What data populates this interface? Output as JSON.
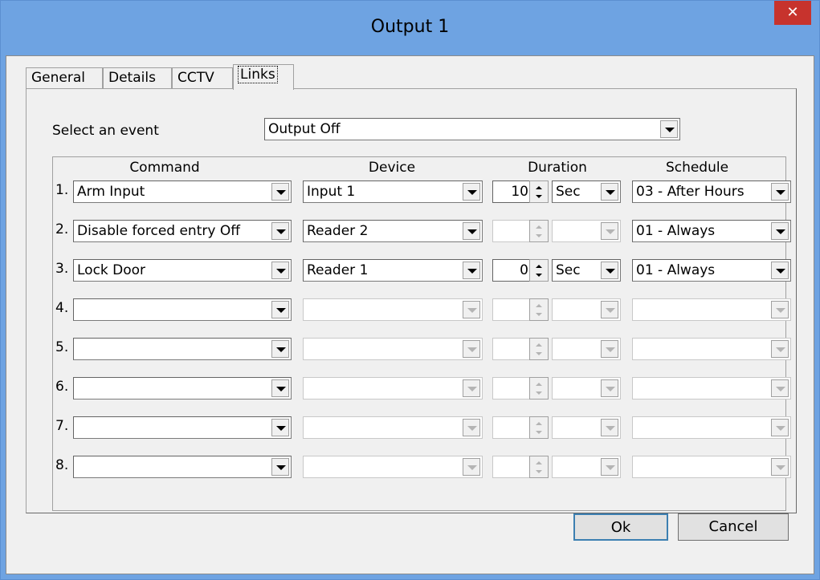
{
  "window": {
    "title": "Output 1",
    "close_glyph": "✕"
  },
  "tabs": [
    {
      "label": "General"
    },
    {
      "label": "Details"
    },
    {
      "label": "CCTV"
    },
    {
      "label": "Links",
      "active": true
    }
  ],
  "event": {
    "label": "Select an event",
    "value": "Output Off"
  },
  "columns": {
    "command": "Command",
    "device": "Device",
    "duration": "Duration",
    "schedule": "Schedule"
  },
  "rows": [
    {
      "num": "1.",
      "command": "Arm Input",
      "device": "Input 1",
      "duration": "10",
      "unit": "Sec",
      "schedule": "03 - After Hours"
    },
    {
      "num": "2.",
      "command": "Disable forced entry Off",
      "device": "Reader 2",
      "duration": "",
      "unit": "",
      "schedule": "01 - Always"
    },
    {
      "num": "3.",
      "command": "Lock Door",
      "device": "Reader 1",
      "duration": "0",
      "unit": "Sec",
      "schedule": "01 - Always"
    },
    {
      "num": "4.",
      "command": "",
      "device": "",
      "duration": "",
      "unit": "",
      "schedule": ""
    },
    {
      "num": "5.",
      "command": "",
      "device": "",
      "duration": "",
      "unit": "",
      "schedule": ""
    },
    {
      "num": "6.",
      "command": "",
      "device": "",
      "duration": "",
      "unit": "",
      "schedule": ""
    },
    {
      "num": "7.",
      "command": "",
      "device": "",
      "duration": "",
      "unit": "",
      "schedule": ""
    },
    {
      "num": "8.",
      "command": "",
      "device": "",
      "duration": "",
      "unit": "",
      "schedule": ""
    }
  ],
  "buttons": {
    "ok": "Ok",
    "cancel": "Cancel"
  }
}
